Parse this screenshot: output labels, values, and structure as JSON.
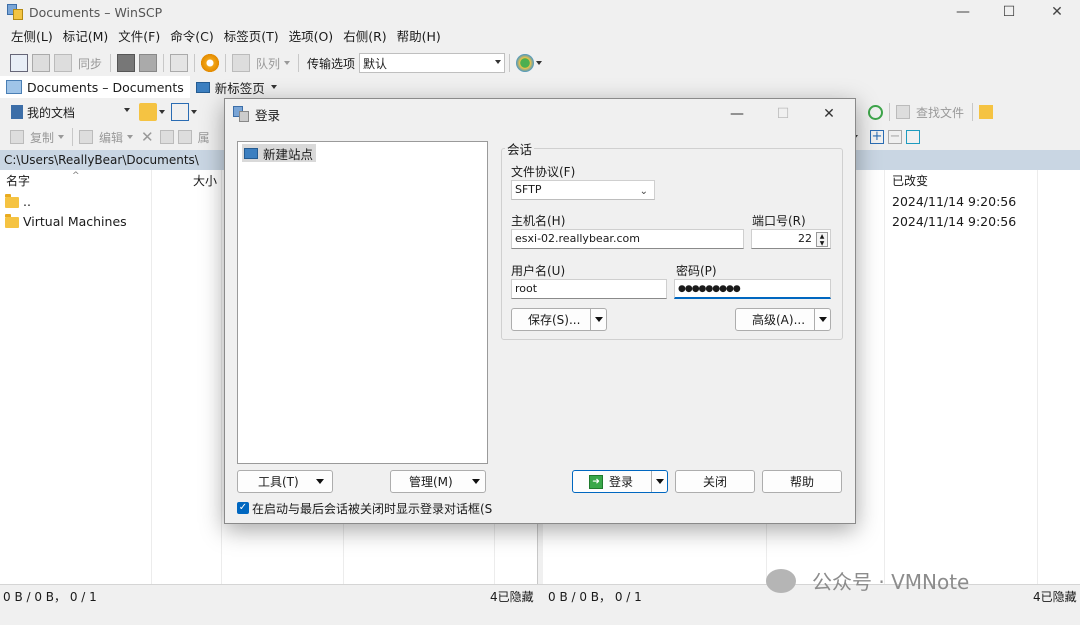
{
  "window": {
    "title": "Documents – WinSCP",
    "minimize": "—",
    "maximize": "☐",
    "close": "✕"
  },
  "menu": [
    "左侧(L)",
    "标记(M)",
    "文件(F)",
    "命令(C)",
    "标签页(T)",
    "选项(O)",
    "右侧(R)",
    "帮助(H)"
  ],
  "toolbar1": {
    "sync": "同步",
    "queue": "队列",
    "transfer_label": "传输选项",
    "transfer_value": "默认"
  },
  "tabs": {
    "tab1": "Documents – Documents",
    "tab2": "新标签页"
  },
  "left_toolbar": {
    "location": "我的文档",
    "copy": "复制",
    "edit": "编辑",
    "props": "属"
  },
  "right_toolbar": {
    "find": "查找文件"
  },
  "left_path": "C:\\Users\\ReallyBear\\Documents\\",
  "left_columns": {
    "name": "名字",
    "size": "大小"
  },
  "right_columns": {
    "changed": "已改变"
  },
  "left_rows": [
    {
      "name": "..",
      "date": "2024/11/14 9:20:56"
    },
    {
      "name": "Virtual Machines",
      "date": "2024/11/14 9:20:56"
    }
  ],
  "status": {
    "left": "0 B / 0 B， 0 / 1",
    "left_hidden": "4已隐藏",
    "right": "0 B / 0 B， 0 / 1",
    "right_hidden": "4已隐藏"
  },
  "watermark": "公众号 · VMNote",
  "login": {
    "title": "登录",
    "site": "新建站点",
    "session_label": "会话",
    "protocol_label": "文件协议(F)",
    "protocol_value": "SFTP",
    "host_label": "主机名(H)",
    "host_value": "esxi-02.reallybear.com",
    "port_label": "端口号(R)",
    "port_value": "22",
    "user_label": "用户名(U)",
    "user_value": "root",
    "pass_label": "密码(P)",
    "pass_value": "●●●●●●●●●",
    "save": "保存(S)...",
    "advanced": "高级(A)...",
    "tools": "工具(T)",
    "manage": "管理(M)",
    "login_btn": "登录",
    "close_btn": "关闭",
    "help_btn": "帮助",
    "show_on_start": "在启动与最后会话被关闭时显示登录对话框(S"
  }
}
